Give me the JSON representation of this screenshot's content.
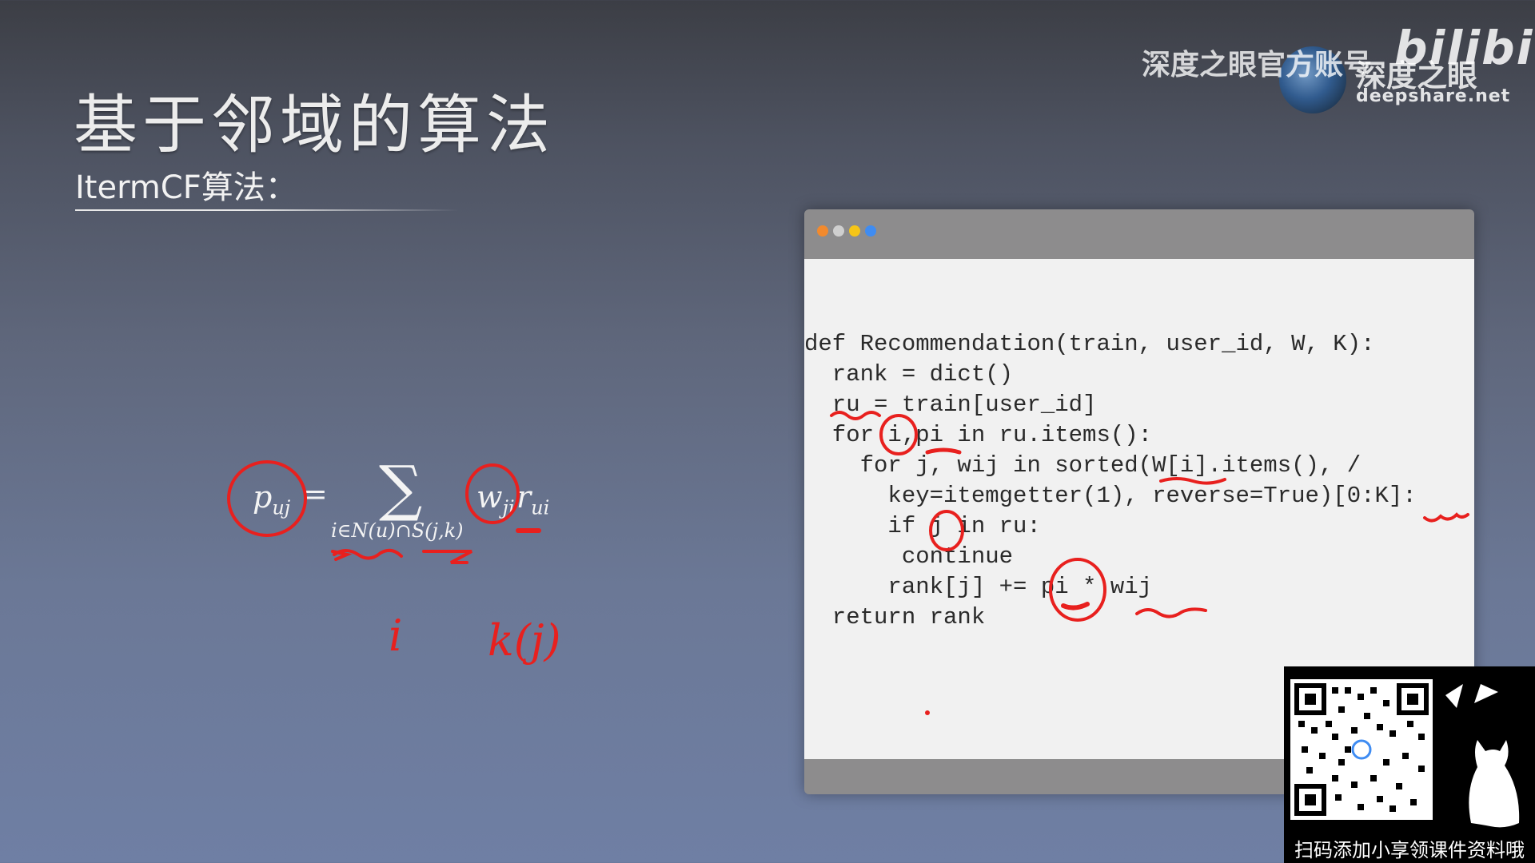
{
  "slide": {
    "title": "基于邻域的算法",
    "subtitle": "ItermCF算法："
  },
  "watermark": {
    "account_text": "深度之眼官方账号",
    "brand": "深度之眼",
    "site_logo": "bilibili",
    "url": "deepshare.net"
  },
  "formula": {
    "lhs": "p",
    "lhs_sub": "uj",
    "equals": "=",
    "sum": "∑",
    "sum_sub": "i∈N(u)∩S(j,k)",
    "w": "w",
    "w_sub": "ji",
    "r": "r",
    "r_sub": "ui",
    "handwritten_i": "i",
    "handwritten_kj": "k(j)"
  },
  "code_window": {
    "dot_colors": [
      "#f28a2e",
      "#cfcfcf",
      "#f5c518",
      "#3f8cf2"
    ],
    "lines": [
      "def Recommendation(train, user_id, W, K):",
      "  rank = dict()",
      "  ru = train[user_id]",
      "  for i,pi in ru.items():",
      "    for j, wij in sorted(W[i].items(), /",
      "      key=itemgetter(1), reverse=True)[0:K]:",
      "      if j in ru:",
      "       continue",
      "      rank[j] += pi * wij",
      "  return rank"
    ]
  },
  "qr_panel": {
    "caption": "扫码添加小享领课件资料哦",
    "icon": "cat-icon"
  },
  "colors": {
    "annotation": "#e8201e"
  }
}
